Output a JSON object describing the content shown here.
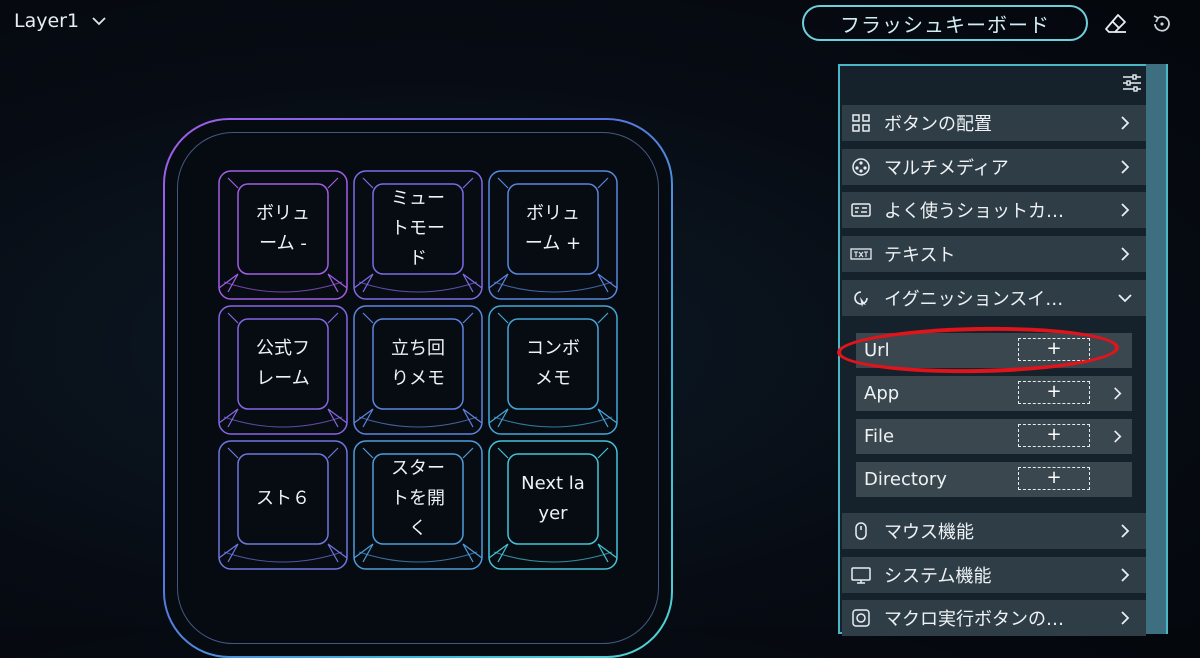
{
  "header": {
    "layer_label": "Layer1",
    "mode_label": "フラッシュキーボード"
  },
  "keypad": {
    "keys": [
      {
        "label": "ボリュ\nーム -"
      },
      {
        "label": "ミュー\nトモー\nド"
      },
      {
        "label": "ボリュ\nーム +"
      },
      {
        "label": "公式フ\nレーム"
      },
      {
        "label": "立ち回\nりメモ"
      },
      {
        "label": "コンボ\nメモ"
      },
      {
        "label": "スト６"
      },
      {
        "label": "スター\nトを開\nく"
      },
      {
        "label": "Next la\nyer"
      }
    ]
  },
  "panel": {
    "categories": [
      {
        "label": "ボタンの配置",
        "icon": "grid-icon"
      },
      {
        "label": "マルチメディア",
        "icon": "media-icon"
      },
      {
        "label": "よく使うショットカ…",
        "icon": "shortcut-icon"
      },
      {
        "label": "テキスト",
        "icon": "text-icon"
      },
      {
        "label": "イグニッションスイ…",
        "icon": "ignition-icon",
        "expanded": true
      },
      {
        "label": "マウス機能",
        "icon": "mouse-icon"
      },
      {
        "label": "システム機能",
        "icon": "monitor-icon"
      },
      {
        "label": "マクロ実行ボタンの…",
        "icon": "macro-icon"
      }
    ],
    "ignition_items": [
      {
        "label": "Url",
        "action": "+"
      },
      {
        "label": "App",
        "action": "+"
      },
      {
        "label": "File",
        "action": "+"
      },
      {
        "label": "Directory",
        "action": "+"
      }
    ]
  },
  "colors": {
    "accent": "#4bb7c6",
    "highlight": "#e0141b",
    "panel_row": "#2f3e46"
  }
}
